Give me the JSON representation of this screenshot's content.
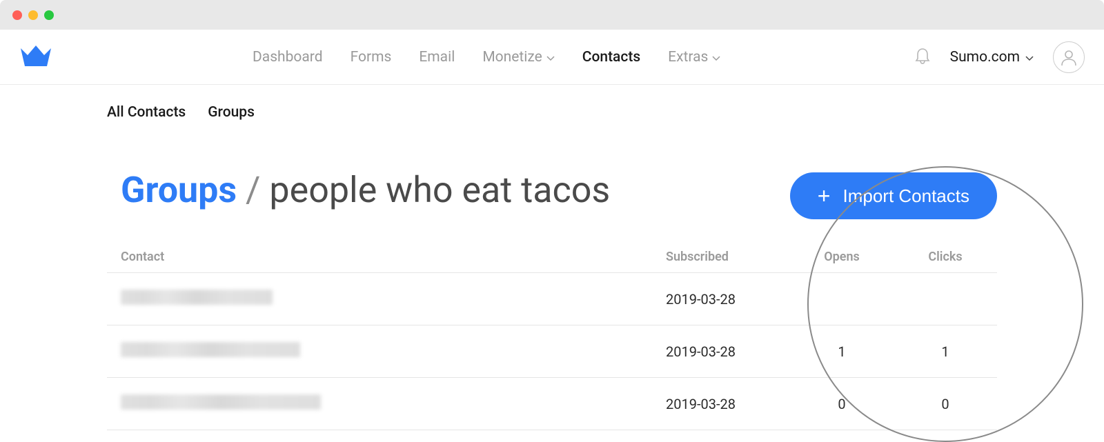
{
  "nav": {
    "items": [
      {
        "label": "Dashboard",
        "active": false,
        "dropdown": false
      },
      {
        "label": "Forms",
        "active": false,
        "dropdown": false
      },
      {
        "label": "Email",
        "active": false,
        "dropdown": false
      },
      {
        "label": "Monetize",
        "active": false,
        "dropdown": true
      },
      {
        "label": "Contacts",
        "active": true,
        "dropdown": false
      },
      {
        "label": "Extras",
        "active": false,
        "dropdown": true
      }
    ],
    "site_name": "Sumo.com"
  },
  "subnav": {
    "items": [
      {
        "label": "All Contacts"
      },
      {
        "label": "Groups"
      }
    ]
  },
  "page": {
    "title_prefix": "Groups",
    "title_sep": " / ",
    "title_name": "people who eat tacos",
    "import_button": "Import Contacts"
  },
  "table": {
    "columns": {
      "contact": "Contact",
      "subscribed": "Subscribed",
      "opens": "Opens",
      "clicks": "Clicks"
    },
    "rows": [
      {
        "contact": "",
        "subscribed": "2019-03-28",
        "opens": "",
        "clicks": ""
      },
      {
        "contact": "",
        "subscribed": "2019-03-28",
        "opens": "1",
        "clicks": "1"
      },
      {
        "contact": "",
        "subscribed": "2019-03-28",
        "opens": "0",
        "clicks": "0"
      }
    ]
  }
}
